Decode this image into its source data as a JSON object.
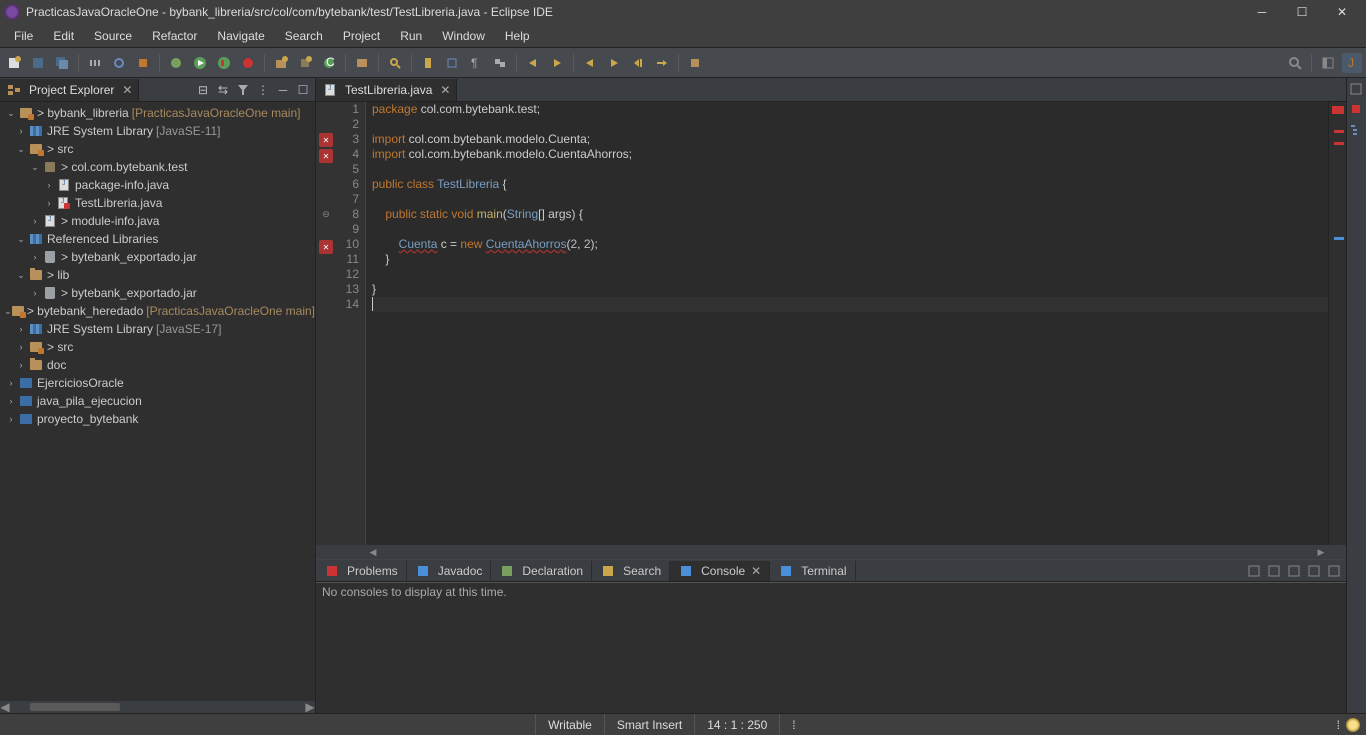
{
  "titlebar": {
    "title": "PracticasJavaOracleOne - bybank_libreria/src/col/com/bytebank/test/TestLibreria.java - Eclipse IDE"
  },
  "menubar": {
    "items": [
      "File",
      "Edit",
      "Source",
      "Refactor",
      "Navigate",
      "Search",
      "Project",
      "Run",
      "Window",
      "Help"
    ]
  },
  "explorer": {
    "tab_label": "Project Explorer",
    "tree": [
      {
        "depth": 0,
        "open": true,
        "icon": "proj",
        "label": "> bybank_libreria",
        "deco": "[PracticasJavaOracleOne main]"
      },
      {
        "depth": 1,
        "open": false,
        "icon": "lib",
        "label": "JRE System Library",
        "deco": "[JavaSE-11]",
        "gray": "deco"
      },
      {
        "depth": 1,
        "open": true,
        "icon": "proj",
        "label": "> src"
      },
      {
        "depth": 2,
        "open": true,
        "icon": "pkg",
        "label": "> col.com.bytebank.test"
      },
      {
        "depth": 3,
        "open": false,
        "icon": "jfile",
        "label": "package-info.java"
      },
      {
        "depth": 3,
        "open": false,
        "icon": "jfile",
        "label": "TestLibreria.java",
        "err": true
      },
      {
        "depth": 2,
        "open": false,
        "icon": "jfile",
        "label": "> module-info.java"
      },
      {
        "depth": 1,
        "open": true,
        "icon": "lib",
        "label": "Referenced Libraries"
      },
      {
        "depth": 2,
        "open": false,
        "icon": "jar",
        "label": "> bytebank_exportado.jar"
      },
      {
        "depth": 1,
        "open": true,
        "icon": "folder",
        "label": "> lib"
      },
      {
        "depth": 2,
        "open": false,
        "icon": "jar",
        "label": "> bytebank_exportado.jar"
      },
      {
        "depth": 0,
        "open": true,
        "icon": "proj",
        "label": "> bytebank_heredado",
        "deco": "[PracticasJavaOracleOne main]"
      },
      {
        "depth": 1,
        "open": false,
        "icon": "lib",
        "label": "JRE System Library",
        "deco": "[JavaSE-17]",
        "gray": "deco"
      },
      {
        "depth": 1,
        "open": false,
        "icon": "proj",
        "label": "> src"
      },
      {
        "depth": 1,
        "open": false,
        "icon": "folder",
        "label": "doc"
      },
      {
        "depth": 0,
        "open": false,
        "icon": "closed-folder",
        "label": "EjerciciosOracle"
      },
      {
        "depth": 0,
        "open": false,
        "icon": "closed-folder",
        "label": "java_pila_ejecucion"
      },
      {
        "depth": 0,
        "open": false,
        "icon": "closed-folder",
        "label": "proyecto_bytebank"
      }
    ]
  },
  "editor": {
    "tab_label": "TestLibreria.java",
    "lines": [
      {
        "n": 1,
        "html": "<span class='kw'>package</span> col.com.bytebank.test;"
      },
      {
        "n": 2,
        "html": ""
      },
      {
        "n": 3,
        "html": "<span class='kw'>import</span> col.com.bytebank.modelo.Cuenta;",
        "err": true,
        "fold": "⊕"
      },
      {
        "n": 4,
        "html": "<span class='kw'>import</span> col.com.bytebank.modelo.CuentaAhorros;",
        "err": true
      },
      {
        "n": 5,
        "html": ""
      },
      {
        "n": 6,
        "html": "<span class='kw'>public</span> <span class='kw'>class</span> <span class='cls'>TestLibreria</span> {"
      },
      {
        "n": 7,
        "html": ""
      },
      {
        "n": 8,
        "html": "    <span class='kw'>public</span> <span class='kw'>static</span> <span class='kw'>void</span> <span class='mth'>main</span>(<span class='cls'>String</span>[] args) {",
        "fold": "⊖"
      },
      {
        "n": 9,
        "html": ""
      },
      {
        "n": 10,
        "html": "        <span class='type'>Cuenta</span> c = <span class='kw'>new</span> <span class='type'>CuentaAhorros</span>(<span class='num'>2</span>, <span class='num'>2</span>);",
        "err": true
      },
      {
        "n": 11,
        "html": "    }"
      },
      {
        "n": 12,
        "html": ""
      },
      {
        "n": 13,
        "html": "}"
      },
      {
        "n": 14,
        "html": "<span style='border-left:1px solid #ccc;'>&nbsp;</span>",
        "cursor": true
      }
    ]
  },
  "bottom": {
    "tabs": [
      {
        "label": "Problems",
        "icon": "#c33"
      },
      {
        "label": "Javadoc",
        "icon": "#4a90d9"
      },
      {
        "label": "Declaration",
        "icon": "#7aa05e"
      },
      {
        "label": "Search",
        "icon": "#c9a74a"
      },
      {
        "label": "Console",
        "icon": "#4a90d9",
        "active": true,
        "close": true
      },
      {
        "label": "Terminal",
        "icon": "#4a90d9"
      }
    ],
    "console_msg": "No consoles to display at this time."
  },
  "statusbar": {
    "writable": "Writable",
    "smart": "Smart Insert",
    "pos": "14 : 1 : 250"
  }
}
